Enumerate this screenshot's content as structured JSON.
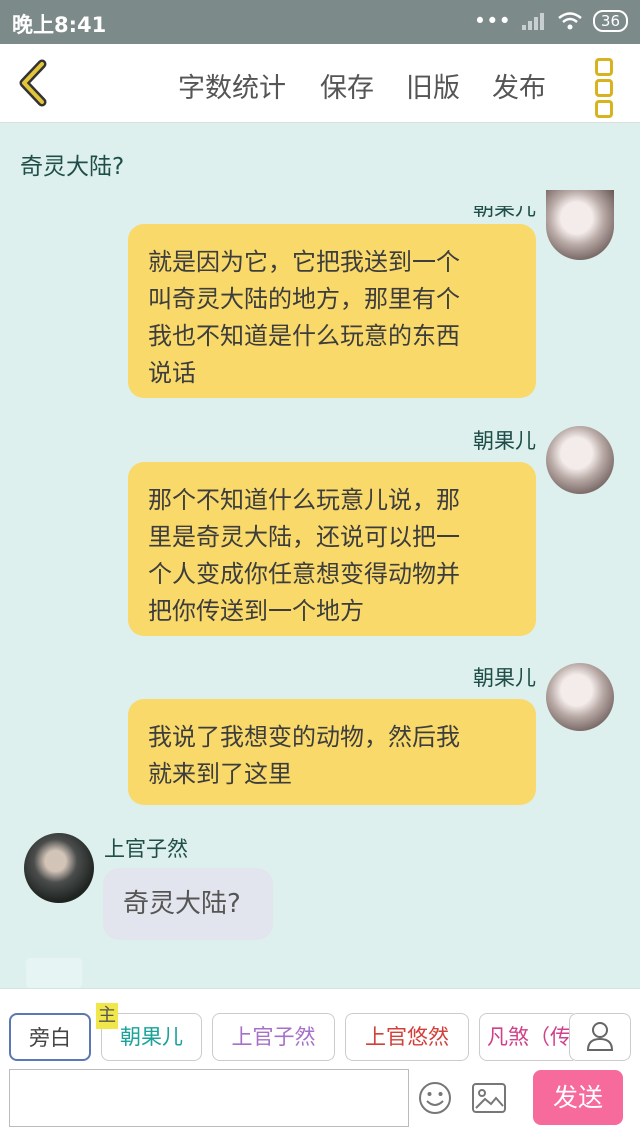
{
  "status_bar": {
    "time": "晚上8:41",
    "signal_dots": "•••",
    "battery": "36"
  },
  "toolbar": {
    "word_count": "字数统计",
    "save": "保存",
    "old_version": "旧版",
    "publish": "发布"
  },
  "chat": {
    "top_text": "奇灵大陆?",
    "messages": [
      {
        "speaker": "朝果儿",
        "text_lines": [
          "就是因为它，它把我送到一个",
          "叫奇灵大陆的地方，那里有个",
          "我也不知道是什么玩意的东西",
          "说话"
        ]
      },
      {
        "speaker": "朝果儿",
        "text_lines": [
          "那个不知道什么玩意儿说，那",
          "里是奇灵大陆，还说可以把一",
          "个人变成你任意想变得动物并",
          "把你传送到一个地方"
        ]
      },
      {
        "speaker": "朝果儿",
        "text_lines": [
          "我说了我想变的动物，然后我",
          "就来到了这里"
        ]
      },
      {
        "speaker": "上官子然",
        "text": "奇灵大陆?"
      }
    ]
  },
  "roles": [
    {
      "label": "旁白",
      "color": "#444444"
    },
    {
      "label": "朝果儿",
      "color": "#1aa39a",
      "tag": "主"
    },
    {
      "label": "上官子然",
      "color": "#a670c8"
    },
    {
      "label": "上官悠然",
      "color": "#d2403a"
    },
    {
      "label": "凡煞（传",
      "color": "#d1408a"
    }
  ],
  "composer": {
    "input_value": "",
    "send_label": "发送"
  },
  "icons": [
    "back-icon",
    "more-icon",
    "person-icon",
    "emoji-icon",
    "image-icon"
  ]
}
